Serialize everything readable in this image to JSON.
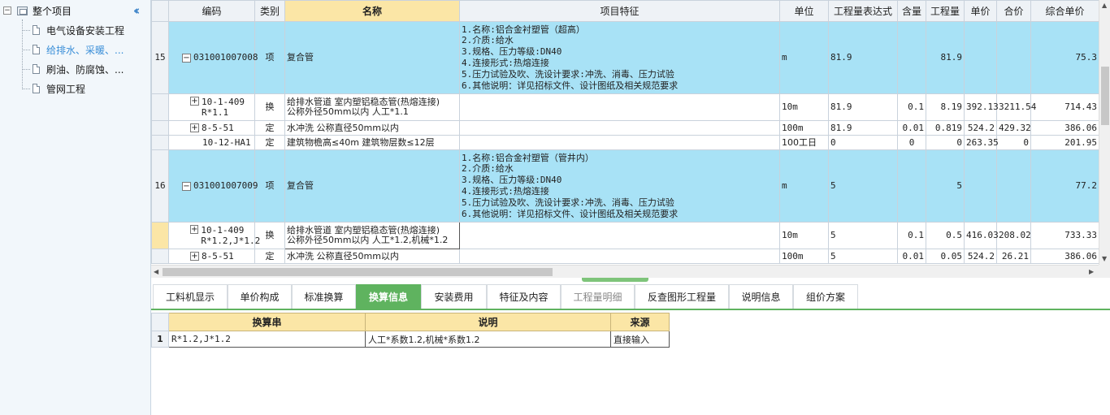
{
  "tree": {
    "root_label": "整个项目",
    "items": [
      {
        "label": "电气设备安装工程",
        "selected": false
      },
      {
        "label": "给排水、采暖、...",
        "selected": true
      },
      {
        "label": "刷油、防腐蚀、...",
        "selected": false
      },
      {
        "label": "管网工程",
        "selected": false
      }
    ]
  },
  "grid": {
    "headers": {
      "code": "编码",
      "type": "类别",
      "name": "名称",
      "features": "项目特征",
      "unit": "单位",
      "expr": "工程量表达式",
      "content": "含量",
      "qty": "工程量",
      "price": "单价",
      "total": "合价",
      "composite": "综合单价"
    },
    "rows": [
      {
        "rownum": "15",
        "code": "031001007008",
        "type": "项",
        "name": "复合管",
        "features": [
          "1.名称:铝合金衬塑管（超高）",
          "2.介质:给水",
          "3.规格、压力等级:DN40",
          "4.连接形式:热熔连接",
          "5.压力试验及吹、洗设计要求:冲洗、消毒、压力试验",
          "6.其他说明：详见招标文件、设计图纸及相关规范要求"
        ],
        "unit": "m",
        "expr": "81.9",
        "content": "",
        "qty": "81.9",
        "price": "",
        "total": "",
        "composite": "75.3"
      },
      {
        "rownum": "",
        "code1": "10-1-409",
        "code2": "R*1.1",
        "type": "换",
        "name1": "给排水管道 室内塑铝稳态管(热熔连接)",
        "name2": "公称外径50mm以内  人工*1.1",
        "unit": "10m",
        "expr": "81.9",
        "content": "0.1",
        "qty": "8.19",
        "price": "392.13",
        "total": "3211.54",
        "composite": "714.43"
      },
      {
        "rownum": "",
        "code": "8-5-51",
        "type": "定",
        "name": "水冲洗 公称直径50mm以内",
        "unit": "100m",
        "expr": "81.9",
        "content": "0.01",
        "qty": "0.819",
        "price": "524.2",
        "total": "429.32",
        "composite": "386.06"
      },
      {
        "rownum": "",
        "code": "10-12-HA1",
        "type": "定",
        "name": "建筑物檐高≤40m 建筑物层数≤12层",
        "unit": "100工日",
        "expr": "0",
        "content": "0",
        "qty": "0",
        "price": "263.35",
        "total": "0",
        "composite": "201.95"
      },
      {
        "rownum": "16",
        "code": "031001007009",
        "type": "项",
        "name": "复合管",
        "features": [
          "1.名称:铝合金衬塑管（管井内）",
          "2.介质:给水",
          "3.规格、压力等级:DN40",
          "4.连接形式:热熔连接",
          "5.压力试验及吹、洗设计要求:冲洗、消毒、压力试验",
          "6.其他说明：详见招标文件、设计图纸及相关规范要求"
        ],
        "unit": "m",
        "expr": "5",
        "content": "",
        "qty": "5",
        "price": "",
        "total": "",
        "composite": "77.2"
      },
      {
        "rownum": "",
        "code1": "10-1-409",
        "code2": "R*1.2,J*1.2",
        "type": "换",
        "name1": "给排水管道 室内塑铝稳态管(热熔连接)",
        "name2": "公称外径50mm以内  人工*1.2,机械*1.2",
        "unit": "10m",
        "expr": "5",
        "content": "0.1",
        "qty": "0.5",
        "price": "416.03",
        "total": "208.02",
        "composite": "733.33"
      },
      {
        "rownum": "",
        "code": "8-5-51",
        "type": "定",
        "name": "水冲洗 公称直径50mm以内",
        "unit": "100m",
        "expr": "5",
        "content": "0.01",
        "qty": "0.05",
        "price": "524.2",
        "total": "26.21",
        "composite": "386.06"
      }
    ]
  },
  "tabs": [
    {
      "label": "工料机显示",
      "state": "normal"
    },
    {
      "label": "单价构成",
      "state": "normal"
    },
    {
      "label": "标准换算",
      "state": "normal"
    },
    {
      "label": "换算信息",
      "state": "active"
    },
    {
      "label": "安装费用",
      "state": "normal"
    },
    {
      "label": "特征及内容",
      "state": "normal"
    },
    {
      "label": "工程量明细",
      "state": "disabled"
    },
    {
      "label": "反查图形工程量",
      "state": "normal"
    },
    {
      "label": "说明信息",
      "state": "normal"
    },
    {
      "label": "组价方案",
      "state": "normal"
    }
  ],
  "sub": {
    "headers": {
      "expr": "换算串",
      "desc": "说明",
      "source": "来源"
    },
    "rows": [
      {
        "rownum": "1",
        "expr": "R*1.2,J*1.2",
        "desc": "人工*系数1.2,机械*系数1.2",
        "source": "直接输入"
      }
    ]
  },
  "colors": {
    "item_row": "#a8e2f6",
    "header_highlight": "#fbe6a6",
    "tab_active": "#5fb35f"
  }
}
